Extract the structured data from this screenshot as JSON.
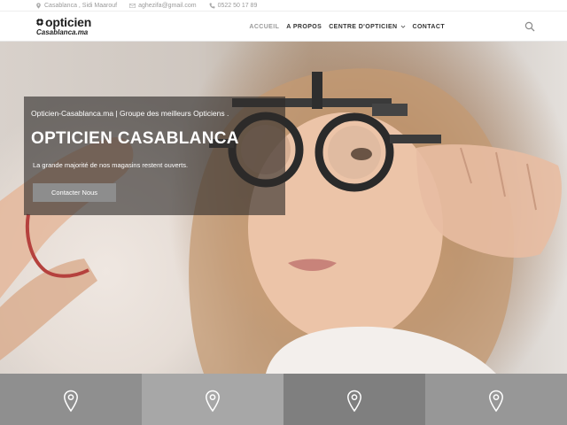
{
  "topbar": {
    "address": "Casablanca , Sidi Maarouf",
    "email": "aghezifa@gmail.com",
    "phone": "0522 50 17 89"
  },
  "logo": {
    "line1": "opticien",
    "line2": "Casablanca.ma"
  },
  "nav": {
    "items": [
      "ACCUEIL",
      "A PROPOS",
      "CENTRE D'OPTICIEN",
      "CONTACT"
    ],
    "active": "ACCUEIL"
  },
  "hero": {
    "subtitle": "Opticien-Casablanca.ma | Groupe des meilleurs Opticiens .",
    "title": "OPTICIEN CASABLANCA",
    "text": "La grande majorité de nos magasins restent ouverts.",
    "button": "Contacter Nous"
  },
  "locations": {
    "colors": [
      "#8f8f8f",
      "#a7a7a7",
      "#7f7f7f",
      "#979797"
    ],
    "icon": "map-pin-icon"
  },
  "colors": {
    "overlay": "#2d2a28",
    "button": "#8d8d8d",
    "nav_active": "#9a9a9a"
  }
}
